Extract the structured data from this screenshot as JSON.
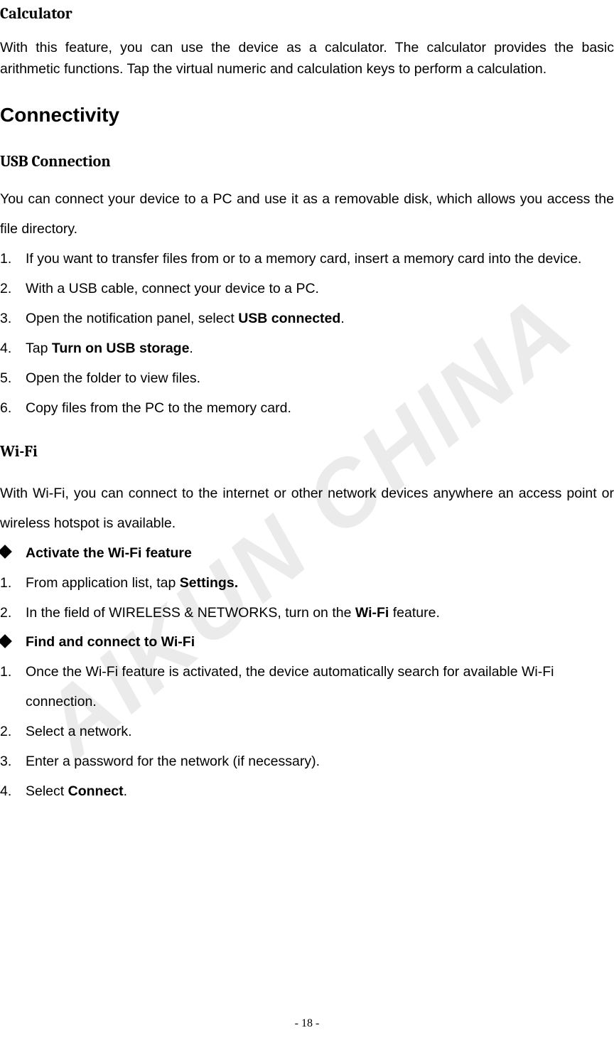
{
  "watermark": "AIKUN CHINA",
  "calculator": {
    "heading": "Calculator",
    "intro": "With this feature, you can use the device as a calculator. The calculator provides the basic arithmetic functions. Tap the virtual numeric and calculation keys to perform a calculation."
  },
  "connectivity": {
    "heading": "Connectivity",
    "usb": {
      "heading": "USB Connection",
      "intro": "You can connect your device to a PC and use it as a removable disk, which allows you access the file directory.",
      "steps": [
        {
          "num": "1.",
          "text": "If you want to transfer files from or to a memory card, insert a memory card into the device."
        },
        {
          "num": "2.",
          "text": "With a USB cable, connect your device to a PC."
        },
        {
          "num": "3.",
          "prefix": "Open the notification panel, select ",
          "bold": "USB connected",
          "suffix": "."
        },
        {
          "num": "4.",
          "prefix": "Tap ",
          "bold": "Turn on USB storage",
          "suffix": "."
        },
        {
          "num": "5.",
          "text": "Open the folder to view files."
        },
        {
          "num": "6.",
          "text": "Copy files from the PC to the memory card."
        }
      ]
    },
    "wifi": {
      "heading": "Wi-Fi",
      "intro": "With Wi-Fi, you can connect to the internet or other network devices anywhere an access point or wireless hotspot is available.",
      "activate": {
        "title": "Activate the Wi-Fi feature",
        "steps": [
          {
            "num": "1.",
            "prefix": "From application list, tap ",
            "bold": "Settings."
          },
          {
            "num": "2.",
            "prefix": "In the field of WIRELESS & NETWORKS, turn on the ",
            "bold": "Wi-Fi",
            "suffix": " feature."
          }
        ]
      },
      "find": {
        "title": "Find and connect to Wi-Fi",
        "steps": [
          {
            "num": "1.",
            "text": "Once the Wi-Fi feature is activated, the device automatically search for available Wi-Fi connection."
          },
          {
            "num": "2.",
            "text": "Select a network."
          },
          {
            "num": "3.",
            "text": "Enter a password for the network (if necessary)."
          },
          {
            "num": "4.",
            "prefix": "Select ",
            "bold": "Connect",
            "suffix": "."
          }
        ]
      }
    }
  },
  "pageNumber": "- 18 -"
}
